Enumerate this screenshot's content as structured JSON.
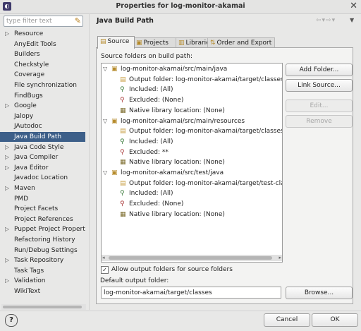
{
  "window": {
    "title": "Properties for log-monitor-akamai",
    "close_glyph": "✕"
  },
  "filter": {
    "placeholder": "type filter text"
  },
  "categories": [
    {
      "label": "Resource",
      "expandable": true
    },
    {
      "label": "AnyEdit Tools",
      "expandable": false
    },
    {
      "label": "Builders",
      "expandable": false
    },
    {
      "label": "Checkstyle",
      "expandable": false
    },
    {
      "label": "Coverage",
      "expandable": false
    },
    {
      "label": "File synchronization",
      "expandable": false
    },
    {
      "label": "FindBugs",
      "expandable": false
    },
    {
      "label": "Google",
      "expandable": true
    },
    {
      "label": "Jalopy",
      "expandable": false
    },
    {
      "label": "JAutodoc",
      "expandable": false
    },
    {
      "label": "Java Build Path",
      "expandable": false,
      "selected": true
    },
    {
      "label": "Java Code Style",
      "expandable": true
    },
    {
      "label": "Java Compiler",
      "expandable": true
    },
    {
      "label": "Java Editor",
      "expandable": true
    },
    {
      "label": "Javadoc Location",
      "expandable": false
    },
    {
      "label": "Maven",
      "expandable": true
    },
    {
      "label": "PMD",
      "expandable": false
    },
    {
      "label": "Project Facets",
      "expandable": false
    },
    {
      "label": "Project References",
      "expandable": false
    },
    {
      "label": "Puppet Project Properties",
      "expandable": true
    },
    {
      "label": "Refactoring History",
      "expandable": false
    },
    {
      "label": "Run/Debug Settings",
      "expandable": false
    },
    {
      "label": "Task Repository",
      "expandable": true
    },
    {
      "label": "Task Tags",
      "expandable": false
    },
    {
      "label": "Validation",
      "expandable": true
    },
    {
      "label": "WikiText",
      "expandable": false
    }
  ],
  "page": {
    "title": "Java Build Path"
  },
  "tabs": [
    {
      "label": "Source",
      "icon": "source-folder-icon",
      "active": true
    },
    {
      "label": "Projects",
      "icon": "projects-icon"
    },
    {
      "label": "Libraries",
      "icon": "libraries-icon"
    },
    {
      "label": "Order and Export",
      "icon": "order-export-icon"
    }
  ],
  "source_label": "Source folders on build path:",
  "source_tree": [
    {
      "level": 0,
      "icon": "package-folder-icon",
      "text": "log-monitor-akamai/src/main/java"
    },
    {
      "level": 1,
      "icon": "output-folder-icon",
      "text": "Output folder: log-monitor-akamai/target/classes"
    },
    {
      "level": 1,
      "icon": "inclusion-filter-icon",
      "text": "Included: (All)"
    },
    {
      "level": 1,
      "icon": "exclusion-filter-icon",
      "text": "Excluded: (None)"
    },
    {
      "level": 1,
      "icon": "native-library-icon",
      "text": "Native library location: (None)"
    },
    {
      "level": 0,
      "icon": "package-folder-icon",
      "text": "log-monitor-akamai/src/main/resources"
    },
    {
      "level": 1,
      "icon": "output-folder-icon",
      "text": "Output folder: log-monitor-akamai/target/classes"
    },
    {
      "level": 1,
      "icon": "inclusion-filter-icon",
      "text": "Included: (All)"
    },
    {
      "level": 1,
      "icon": "exclusion-filter-icon",
      "text": "Excluded: **"
    },
    {
      "level": 1,
      "icon": "native-library-icon",
      "text": "Native library location: (None)"
    },
    {
      "level": 0,
      "icon": "package-folder-icon",
      "text": "log-monitor-akamai/src/test/java"
    },
    {
      "level": 1,
      "icon": "output-folder-icon",
      "text": "Output folder: log-monitor-akamai/target/test-classes"
    },
    {
      "level": 1,
      "icon": "inclusion-filter-icon",
      "text": "Included: (All)"
    },
    {
      "level": 1,
      "icon": "exclusion-filter-icon",
      "text": "Excluded: (None)"
    },
    {
      "level": 1,
      "icon": "native-library-icon",
      "text": "Native library location: (None)"
    }
  ],
  "buttons": {
    "add_folder": "Add Folder...",
    "link_source": "Link Source...",
    "edit": "Edit...",
    "remove": "Remove",
    "browse": "Browse...",
    "cancel": "Cancel",
    "ok": "OK"
  },
  "allow_output": {
    "label": "Allow output folders for source folders",
    "checked": true
  },
  "default_output": {
    "label": "Default output folder:",
    "value": "log-monitor-akamai/target/classes"
  },
  "help": {
    "glyph": "?"
  }
}
